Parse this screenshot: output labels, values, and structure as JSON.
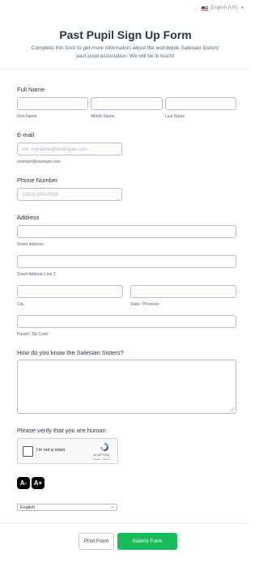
{
  "language_top": {
    "label": "English (US)"
  },
  "header": {
    "title": "Past Pupil Sign Up Form",
    "subtitle_line1": "Complete this form to get more information about the worldwide Salesian Sisters'",
    "subtitle_line2": "past pupil association. We will be in touch!"
  },
  "full_name": {
    "label": "Full Name",
    "first_sub": "First Name",
    "middle_sub": "Middle Name",
    "last_sub": "Last Name"
  },
  "email": {
    "label": "E-mail",
    "placeholder": "ex: myname@example.com",
    "sub": "example@example.com"
  },
  "phone": {
    "label": "Phone Number",
    "placeholder": "(000) 000-0000"
  },
  "address": {
    "label": "Address",
    "street_sub": "Street Address",
    "street2_sub": "Street Address Line 2",
    "city_sub": "City",
    "state_sub": "State / Province",
    "postal_sub": "Postal / Zip Code"
  },
  "question": {
    "label": "How do you know the Salesian Sisters?"
  },
  "captcha": {
    "label": "Please verify that you are human",
    "text": "I'm not a robot",
    "brand": "reCAPTCHA",
    "terms": "Privacy - Terms"
  },
  "accessibility": {
    "decrease": "A-",
    "increase": "A+"
  },
  "language_select": {
    "value": "English"
  },
  "footer": {
    "print_label": "Print Form",
    "submit_label": "Submit Form"
  },
  "colors": {
    "submit": "#18bd5b",
    "text": "#2c3345",
    "border": "#b8bdc9"
  }
}
